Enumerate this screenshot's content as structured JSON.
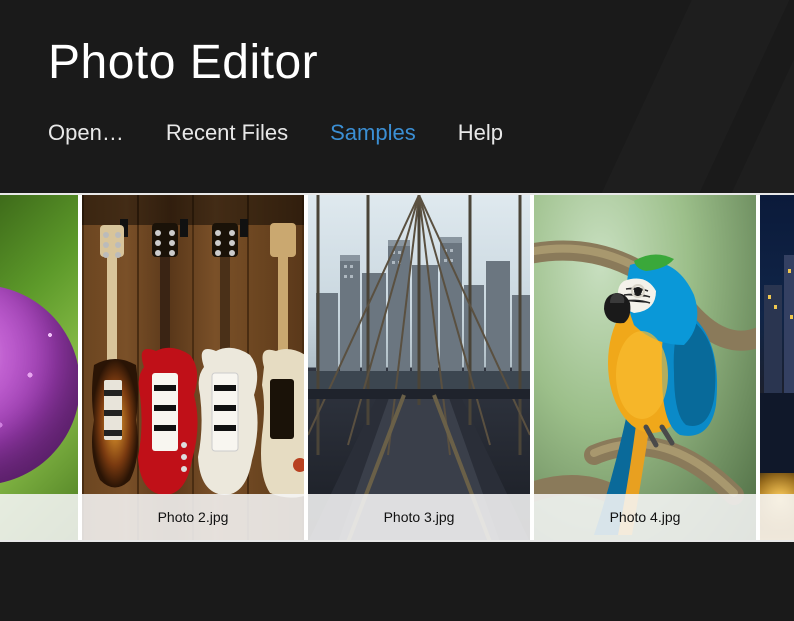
{
  "app": {
    "title": "Photo Editor"
  },
  "nav": {
    "open": "Open…",
    "recent": "Recent Files",
    "samples": "Samples",
    "help": "Help",
    "active": "samples"
  },
  "gallery": {
    "items": [
      {
        "caption": "",
        "desc": "purple-allium-flower"
      },
      {
        "caption": "Photo 2.jpg",
        "desc": "electric-guitars"
      },
      {
        "caption": "Photo 3.jpg",
        "desc": "city-skyline-bridge"
      },
      {
        "caption": "Photo 4.jpg",
        "desc": "blue-yellow-macaw"
      },
      {
        "caption": "",
        "desc": "night-city-lights"
      }
    ]
  }
}
